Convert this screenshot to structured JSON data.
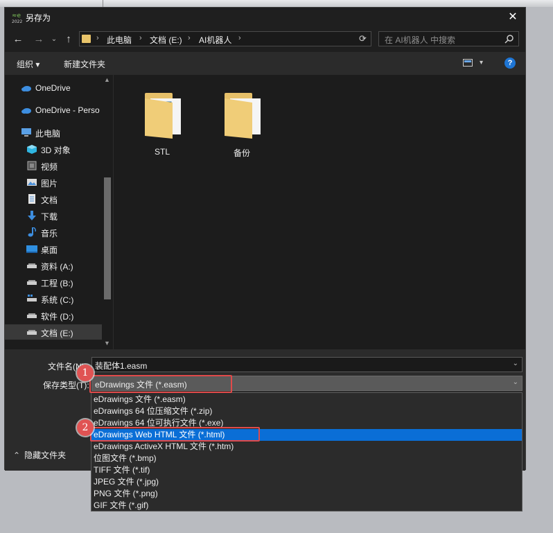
{
  "dialog": {
    "title": "另存为",
    "close": "✕"
  },
  "nav": {
    "back": "←",
    "forward": "→",
    "recent": "⌄",
    "up": "↑",
    "breadcrumb": [
      "此电脑",
      "文档 (E:)",
      "AI机器人"
    ],
    "separator": "›",
    "refresh": "⟳",
    "search_placeholder": "在 AI机器人 中搜索"
  },
  "toolbar": {
    "organize": "组织 ▾",
    "new_folder": "新建文件夹",
    "view_chevron": "▾",
    "help": "?"
  },
  "sidebar": {
    "items": [
      {
        "label": "OneDrive",
        "icon": "cloud-icon"
      },
      {
        "label": "OneDrive - Perso",
        "icon": "cloud-icon"
      },
      {
        "label": "此电脑",
        "icon": "pc-icon"
      },
      {
        "label": "3D 对象",
        "icon": "cube-icon"
      },
      {
        "label": "视频",
        "icon": "video-icon"
      },
      {
        "label": "图片",
        "icon": "picture-icon"
      },
      {
        "label": "文档",
        "icon": "document-icon"
      },
      {
        "label": "下载",
        "icon": "download-icon"
      },
      {
        "label": "音乐",
        "icon": "music-icon"
      },
      {
        "label": "桌面",
        "icon": "desktop-icon"
      },
      {
        "label": "资料 (A:)",
        "icon": "drive-icon"
      },
      {
        "label": "工程 (B:)",
        "icon": "drive-icon"
      },
      {
        "label": "系统 (C:)",
        "icon": "system-drive-icon"
      },
      {
        "label": "软件 (D:)",
        "icon": "drive-icon"
      },
      {
        "label": "文档 (E:)",
        "icon": "drive-icon"
      }
    ]
  },
  "files": [
    {
      "name": "STL",
      "icon": "folder-icon"
    },
    {
      "name": "备份",
      "icon": "folder-icon"
    }
  ],
  "form": {
    "filename_label": "文件名(N):",
    "filename_value": "装配体1.easm",
    "savetype_label": "保存类型(T):",
    "savetype_value": "eDrawings 文件 (*.easm)",
    "hide_folders": "隐藏文件夹"
  },
  "savetype_options": [
    "eDrawings 文件 (*.easm)",
    "eDrawings 64 位压缩文件 (*.zip)",
    "eDrawings 64 位可执行文件 (*.exe)",
    "eDrawings Web HTML 文件 (*.html)",
    "eDrawings ActiveX HTML 文件 (*.htm)",
    "位图文件 (*.bmp)",
    "TIFF 文件 (*.tif)",
    "JPEG 文件 (*.jpg)",
    "PNG 文件 (*.png)",
    "GIF 文件 (*.gif)"
  ],
  "selected_option_index": 3,
  "annotations": {
    "badge1": "1",
    "badge2": "2"
  },
  "colors": {
    "accent": "#0a6ed6",
    "annotation": "#e14a4a",
    "folder": "#e8c46a"
  }
}
